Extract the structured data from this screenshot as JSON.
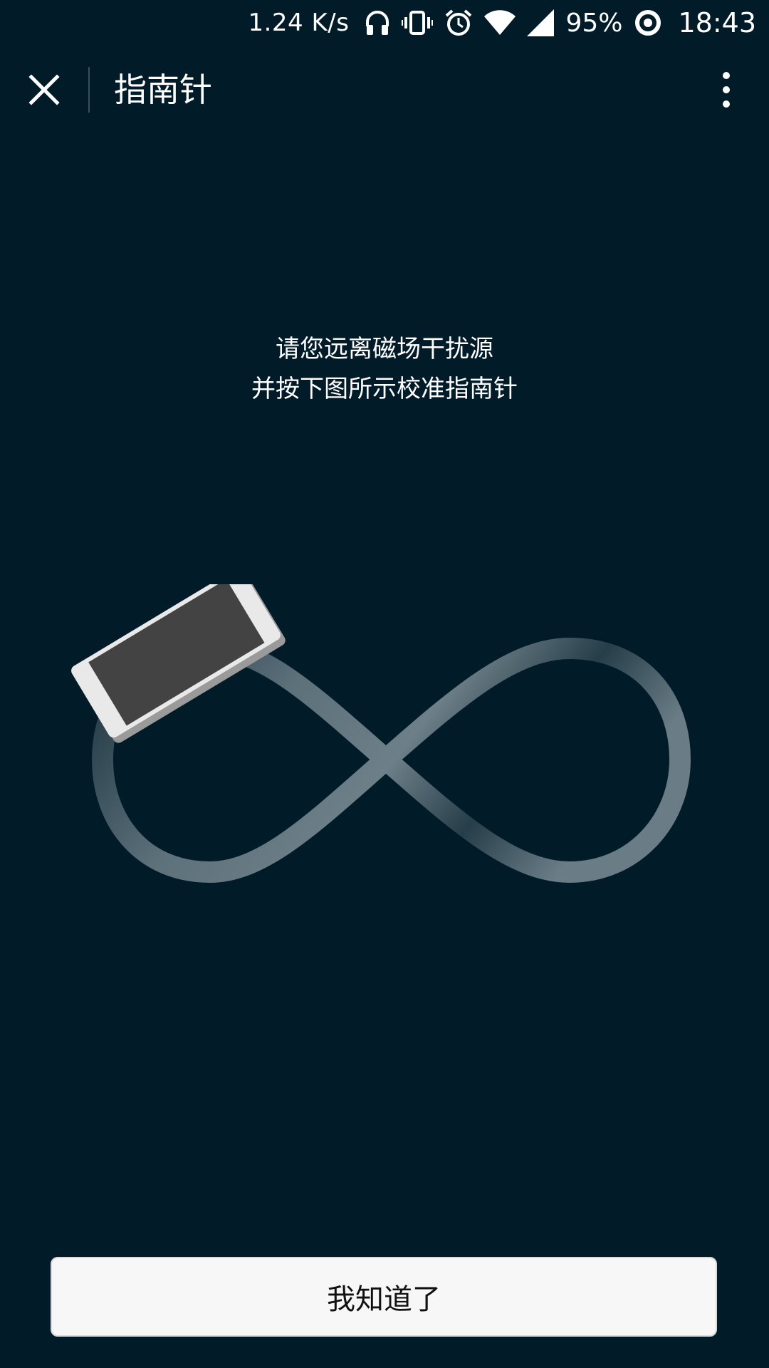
{
  "status_bar": {
    "net_speed": "1.24 K/s",
    "battery_percent": "95%",
    "time": "18:43",
    "icons": [
      "headphones-icon",
      "vibrate-icon",
      "alarm-icon",
      "wifi-icon",
      "signal-icon",
      "battery-saver-icon"
    ]
  },
  "header": {
    "title": "指南针",
    "close_icon": "close-icon",
    "more_icon": "more-vertical-icon"
  },
  "main": {
    "instruction_line1": "请您远离磁场干扰源",
    "instruction_line2": "并按下图所示校准指南针",
    "illustration": "phone-figure-eight-calibration"
  },
  "footer": {
    "ok_label": "我知道了"
  },
  "colors": {
    "background": "#021b29",
    "button_bg": "#f7f7f7",
    "text": "#ffffff"
  }
}
